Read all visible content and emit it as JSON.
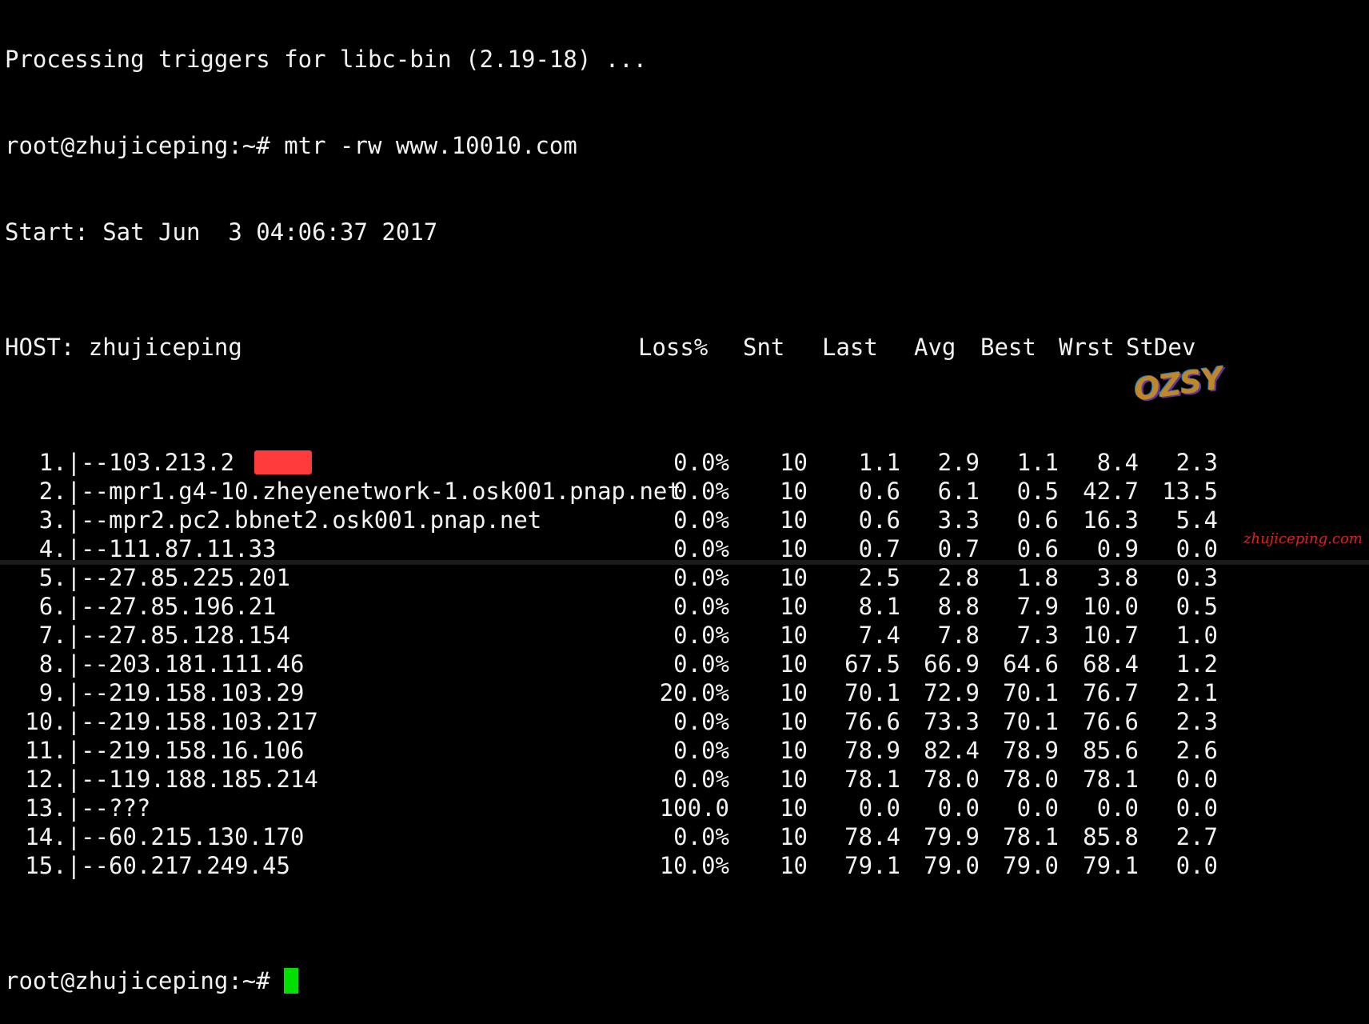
{
  "terminal": {
    "top_line": "Processing triggers for libc-bin (2.19-18) ...",
    "prompt_cmd": "root@zhujiceping:~# mtr -rw www.10010.com",
    "start_line": "Start: Sat Jun  3 04:06:37 2017",
    "header": {
      "host": "HOST: zhujiceping",
      "loss": "Loss%",
      "snt": "Snt",
      "last": "Last",
      "avg": "Avg",
      "best": "Best",
      "wrst": "Wrst",
      "stdev": "StDev"
    },
    "hops": [
      {
        "num": "1.|--",
        "host": "103.213.2",
        "loss": "0.0%",
        "snt": "10",
        "last": "1.1",
        "avg": "2.9",
        "best": "1.1",
        "wrst": "8.4",
        "stdev": "2.3"
      },
      {
        "num": "2.|--",
        "host": "mpr1.g4-10.zheyenetwork-1.osk001.pnap.net",
        "loss": "0.0%",
        "snt": "10",
        "last": "0.6",
        "avg": "6.1",
        "best": "0.5",
        "wrst": "42.7",
        "stdev": "13.5"
      },
      {
        "num": "3.|--",
        "host": "mpr2.pc2.bbnet2.osk001.pnap.net",
        "loss": "0.0%",
        "snt": "10",
        "last": "0.6",
        "avg": "3.3",
        "best": "0.6",
        "wrst": "16.3",
        "stdev": "5.4"
      },
      {
        "num": "4.|--",
        "host": "111.87.11.33",
        "loss": "0.0%",
        "snt": "10",
        "last": "0.7",
        "avg": "0.7",
        "best": "0.6",
        "wrst": "0.9",
        "stdev": "0.0"
      },
      {
        "num": "5.|--",
        "host": "27.85.225.201",
        "loss": "0.0%",
        "snt": "10",
        "last": "2.5",
        "avg": "2.8",
        "best": "1.8",
        "wrst": "3.8",
        "stdev": "0.3"
      },
      {
        "num": "6.|--",
        "host": "27.85.196.21",
        "loss": "0.0%",
        "snt": "10",
        "last": "8.1",
        "avg": "8.8",
        "best": "7.9",
        "wrst": "10.0",
        "stdev": "0.5"
      },
      {
        "num": "7.|--",
        "host": "27.85.128.154",
        "loss": "0.0%",
        "snt": "10",
        "last": "7.4",
        "avg": "7.8",
        "best": "7.3",
        "wrst": "10.7",
        "stdev": "1.0"
      },
      {
        "num": "8.|--",
        "host": "203.181.111.46",
        "loss": "0.0%",
        "snt": "10",
        "last": "67.5",
        "avg": "66.9",
        "best": "64.6",
        "wrst": "68.4",
        "stdev": "1.2"
      },
      {
        "num": "9.|--",
        "host": "219.158.103.29",
        "loss": "20.0%",
        "snt": "10",
        "last": "70.1",
        "avg": "72.9",
        "best": "70.1",
        "wrst": "76.7",
        "stdev": "2.1"
      },
      {
        "num": "10.|--",
        "host": "219.158.103.217",
        "loss": "0.0%",
        "snt": "10",
        "last": "76.6",
        "avg": "73.3",
        "best": "70.1",
        "wrst": "76.6",
        "stdev": "2.3"
      },
      {
        "num": "11.|--",
        "host": "219.158.16.106",
        "loss": "0.0%",
        "snt": "10",
        "last": "78.9",
        "avg": "82.4",
        "best": "78.9",
        "wrst": "85.6",
        "stdev": "2.6"
      },
      {
        "num": "12.|--",
        "host": "119.188.185.214",
        "loss": "0.0%",
        "snt": "10",
        "last": "78.1",
        "avg": "78.0",
        "best": "78.0",
        "wrst": "78.1",
        "stdev": "0.0"
      },
      {
        "num": "13.|--",
        "host": "???",
        "loss": "100.0",
        "snt": "10",
        "last": "0.0",
        "avg": "0.0",
        "best": "0.0",
        "wrst": "0.0",
        "stdev": "0.0"
      },
      {
        "num": "14.|--",
        "host": "60.215.130.170",
        "loss": "0.0%",
        "snt": "10",
        "last": "78.4",
        "avg": "79.9",
        "best": "78.1",
        "wrst": "85.8",
        "stdev": "2.7"
      },
      {
        "num": "15.|--",
        "host": "60.217.249.45",
        "loss": "10.0%",
        "snt": "10",
        "last": "79.1",
        "avg": "79.0",
        "best": "79.0",
        "wrst": "79.1",
        "stdev": "0.0"
      }
    ],
    "final_prompt": "root@zhujiceping:~# ",
    "colors": {
      "background": "#000000",
      "text": "#f2f2f2",
      "cursor": "#00e000",
      "redaction": "#ff3b3b"
    }
  },
  "watermarks": {
    "logo": "OZSY",
    "site": "zhujiceping.com"
  }
}
